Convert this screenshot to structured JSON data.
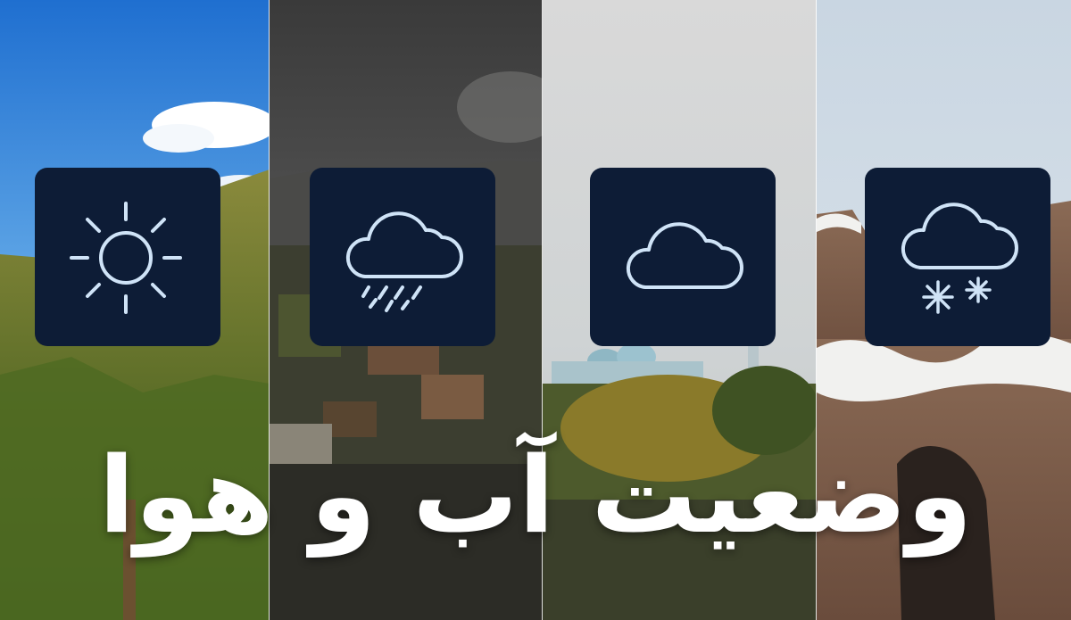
{
  "title_text": "وضعیت آب و هوا",
  "panels": [
    {
      "scene": "sunny-mountain",
      "icon": "sun-icon"
    },
    {
      "scene": "stormy-town",
      "icon": "rain-cloud-icon"
    },
    {
      "scene": "overcast-city",
      "icon": "cloud-icon"
    },
    {
      "scene": "snowy-ruins",
      "icon": "snow-cloud-icon"
    }
  ],
  "colors": {
    "tile_background": "#0d1c36",
    "icon_stroke": "#cfe3f7",
    "title_text": "#ffffff"
  }
}
